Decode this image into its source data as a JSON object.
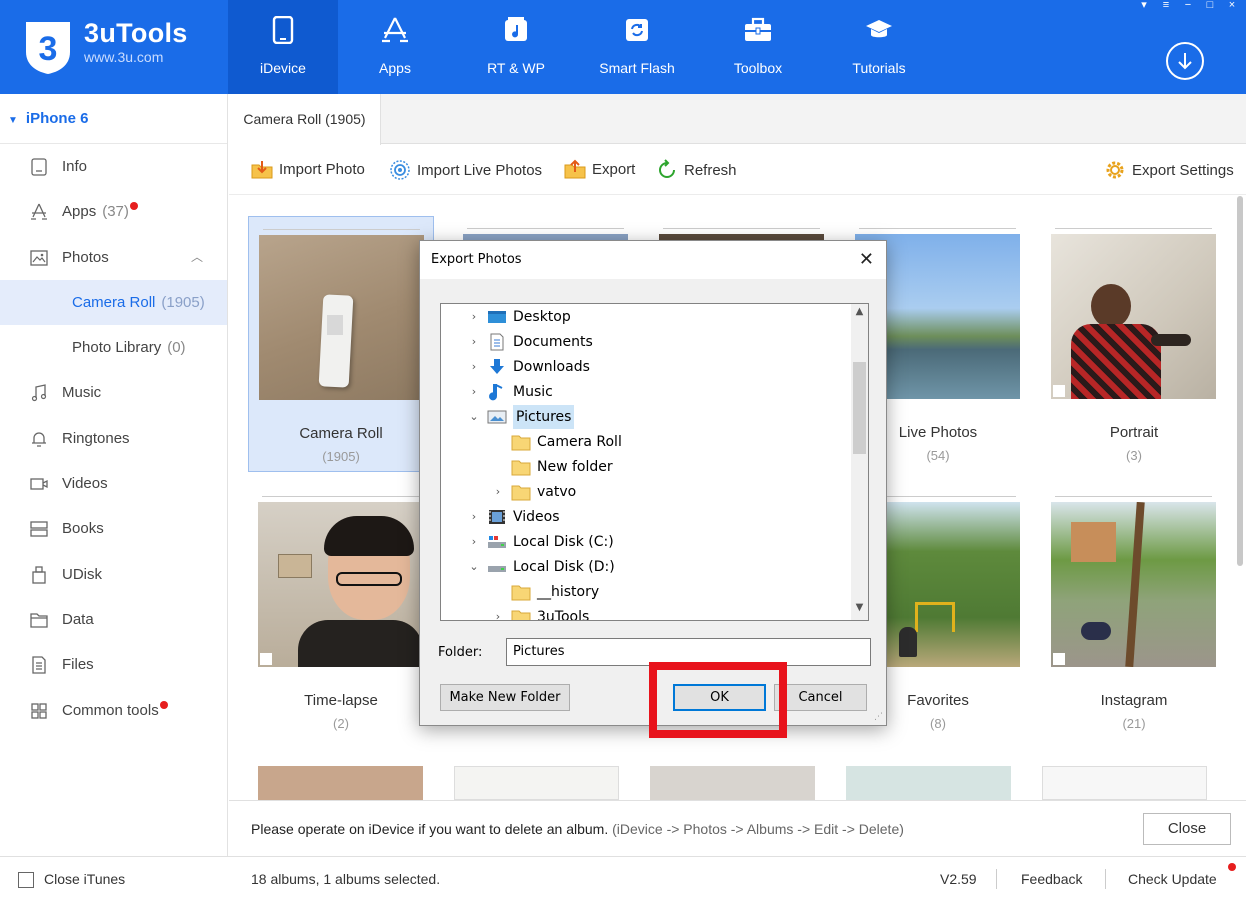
{
  "app": {
    "name": "3uTools",
    "url": "www.3u.com",
    "logo_text": "3"
  },
  "nav": [
    {
      "label": "iDevice",
      "icon": "phone-icon",
      "active": true
    },
    {
      "label": "Apps",
      "icon": "apps-icon",
      "active": false
    },
    {
      "label": "RT & WP",
      "icon": "music-note-icon",
      "active": false
    },
    {
      "label": "Smart Flash",
      "icon": "flash-refresh-icon",
      "active": false
    },
    {
      "label": "Toolbox",
      "icon": "toolbox-icon",
      "active": false
    },
    {
      "label": "Tutorials",
      "icon": "graduation-cap-icon",
      "active": false
    }
  ],
  "sidebar": {
    "device": "iPhone 6",
    "items": [
      {
        "label": "Info",
        "icon": "info-icon"
      },
      {
        "label": "Apps",
        "count": "(37)",
        "icon": "apps-icon",
        "badge": true
      },
      {
        "label": "Photos",
        "icon": "photos-icon"
      },
      {
        "label": "Camera Roll",
        "count": "(1905)",
        "sub": true,
        "selected": true
      },
      {
        "label": "Photo Library",
        "count": "(0)",
        "sub": true
      },
      {
        "label": "Music",
        "icon": "music-icon"
      },
      {
        "label": "Ringtones",
        "icon": "bell-icon"
      },
      {
        "label": "Videos",
        "icon": "video-icon"
      },
      {
        "label": "Books",
        "icon": "books-icon"
      },
      {
        "label": "UDisk",
        "icon": "udisk-icon"
      },
      {
        "label": "Data",
        "icon": "folder-icon"
      },
      {
        "label": "Files",
        "icon": "file-icon"
      },
      {
        "label": "Common tools",
        "icon": "grid-icon",
        "badge": true
      }
    ]
  },
  "tab": {
    "label": "Camera Roll (1905)"
  },
  "toolbar": {
    "import_photo": "Import Photo",
    "import_live": "Import Live Photos",
    "export": "Export",
    "refresh": "Refresh",
    "export_settings": "Export Settings"
  },
  "albums": [
    {
      "name": "Camera Roll",
      "count": "(1905)"
    },
    {
      "name": "Live Photos",
      "count": "(54)"
    },
    {
      "name": "Portrait",
      "count": "(3)"
    },
    {
      "name": "Time-lapse",
      "count": "(2)"
    },
    {
      "name": "Favorites",
      "count": "(8)"
    },
    {
      "name": "Instagram",
      "count": "(21)"
    }
  ],
  "bottom": {
    "message": "Please operate on iDevice if you want to delete an album.",
    "hint": "(iDevice -> Photos -> Albums -> Edit -> Delete)",
    "close": "Close"
  },
  "status": {
    "close_itunes": "Close iTunes",
    "summary": "18 albums, 1 albums selected.",
    "version": "V2.59",
    "feedback": "Feedback",
    "check_update": "Check Update"
  },
  "dialog": {
    "title": "Export Photos",
    "tree": [
      {
        "label": "Desktop",
        "level": 0,
        "expander": ">",
        "icon": "desktop-icon"
      },
      {
        "label": "Documents",
        "level": 0,
        "expander": ">",
        "icon": "documents-icon"
      },
      {
        "label": "Downloads",
        "level": 0,
        "expander": ">",
        "icon": "download-arrow-icon"
      },
      {
        "label": "Music",
        "level": 0,
        "expander": ">",
        "icon": "music-note-icon"
      },
      {
        "label": "Pictures",
        "level": 0,
        "expander": "v",
        "icon": "pictures-icon",
        "selected": true
      },
      {
        "label": "Camera Roll",
        "level": 1,
        "expander": "",
        "icon": "folder-icon"
      },
      {
        "label": "New folder",
        "level": 1,
        "expander": "",
        "icon": "folder-icon"
      },
      {
        "label": "vatvo",
        "level": 1,
        "expander": ">",
        "icon": "folder-icon"
      },
      {
        "label": "Videos",
        "level": 0,
        "expander": ">",
        "icon": "videos-icon"
      },
      {
        "label": "Local Disk (C:)",
        "level": 0,
        "expander": ">",
        "icon": "drive-icon"
      },
      {
        "label": "Local Disk (D:)",
        "level": 0,
        "expander": "v",
        "icon": "drive-icon"
      },
      {
        "label": "__history",
        "level": 1,
        "expander": "",
        "icon": "folder-icon"
      },
      {
        "label": "3uTools",
        "level": 1,
        "expander": ">",
        "icon": "folder-icon"
      }
    ],
    "folder_label": "Folder:",
    "folder_value": "Pictures",
    "make_new_folder": "Make New Folder",
    "ok": "OK",
    "cancel": "Cancel"
  },
  "colors": {
    "header": "#1a6ce8",
    "selection": "#e4ecfb",
    "highlight": "#e8131c",
    "badge": "#e61e1e"
  }
}
